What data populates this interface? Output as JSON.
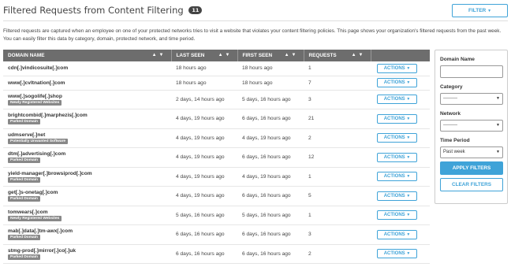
{
  "header": {
    "title": "Filtered Requests from Content Filtering",
    "count": "11",
    "filter_label": "FILTER"
  },
  "description": "Filtered requests are captured when an employee on one of your protected networks tries to visit a website that violates your content filtering policies. This page shows your organization's filtered requests from the past week. You can easily filter this data by category, domain, protected network, and time period.",
  "table": {
    "columns": [
      "DOMAIN NAME",
      "LAST SEEN",
      "FIRST SEEN",
      "REQUESTS"
    ],
    "action_label": "ACTIONS",
    "rows": [
      {
        "domain": "cdn[.]vindicosuite[.]com",
        "tag": "",
        "last_seen": "18 hours ago",
        "first_seen": "18 hours ago",
        "requests": "1"
      },
      {
        "domain": "www[.]cvltnation[.]com",
        "tag": "",
        "last_seen": "18 hours ago",
        "first_seen": "18 hours ago",
        "requests": "7"
      },
      {
        "domain": "www[.]sogolife[.]shop",
        "tag": "Newly Registered Websites",
        "last_seen": "2 days, 14 hours ago",
        "first_seen": "5 days, 16 hours ago",
        "requests": "3"
      },
      {
        "domain": "brightcombid[.]marphezis[.]com",
        "tag": "Parked Domain",
        "last_seen": "4 days, 19 hours ago",
        "first_seen": "6 days, 16 hours ago",
        "requests": "21"
      },
      {
        "domain": "udmserve[.]net",
        "tag": "Potentially Unwanted Software",
        "last_seen": "4 days, 19 hours ago",
        "first_seen": "4 days, 19 hours ago",
        "requests": "2"
      },
      {
        "domain": "dtm[.]advertising[.]com",
        "tag": "Parked Domain",
        "last_seen": "4 days, 19 hours ago",
        "first_seen": "6 days, 16 hours ago",
        "requests": "12"
      },
      {
        "domain": "yield-manager[.]browsiprod[.]com",
        "tag": "Parked Domain",
        "last_seen": "4 days, 19 hours ago",
        "first_seen": "4 days, 19 hours ago",
        "requests": "1"
      },
      {
        "domain": "get[.]s-onetag[.]com",
        "tag": "Parked Domain",
        "last_seen": "4 days, 19 hours ago",
        "first_seen": "6 days, 16 hours ago",
        "requests": "5"
      },
      {
        "domain": "tomwears[.]com",
        "tag": "Newly Registered Websites",
        "last_seen": "5 days, 16 hours ago",
        "first_seen": "5 days, 16 hours ago",
        "requests": "1"
      },
      {
        "domain": "mab[.]data[.]tm-awx[.]com",
        "tag": "Parked Domain",
        "last_seen": "6 days, 16 hours ago",
        "first_seen": "6 days, 16 hours ago",
        "requests": "3"
      },
      {
        "domain": "stmg-prod[.]mirror[.]co[.]uk",
        "tag": "Parked Domain",
        "last_seen": "6 days, 16 hours ago",
        "first_seen": "6 days, 16 hours ago",
        "requests": "2"
      }
    ]
  },
  "filters": {
    "domain_label": "Domain Name",
    "domain_value": "",
    "category_label": "Category",
    "category_value": "---------",
    "network_label": "Network",
    "network_value": "---------",
    "time_label": "Time Period",
    "time_value": "Past week",
    "apply_label": "APPLY FILTERS",
    "clear_label": "CLEAR FILTERS"
  },
  "colors": {
    "accent": "#3fa3d8",
    "header_bg": "#6d6d6d",
    "tag_bg": "#888888"
  }
}
